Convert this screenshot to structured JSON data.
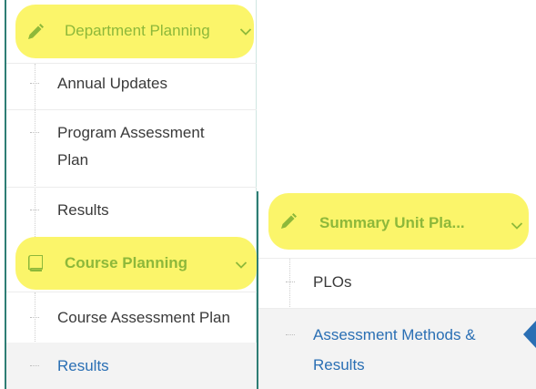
{
  "left_menu": {
    "department_planning": {
      "label": "Department Planning",
      "icon": "pencil-icon",
      "chevron": "chevron-down-icon"
    },
    "department_items": [
      "Annual Updates",
      "Program Assessment",
      "Plan",
      "Results"
    ],
    "course_planning": {
      "label": "Course Planning",
      "icon": "book-icon",
      "chevron": "chevron-down-icon"
    },
    "course_items": [
      "Course Assessment Plan",
      "Results"
    ]
  },
  "right_menu": {
    "summary_unit": {
      "label": "Summary Unit Pla...",
      "icon": "pencil-icon",
      "chevron": "chevron-down-icon"
    },
    "items": [
      "PLOs",
      "Assessment Methods &",
      "Results"
    ]
  },
  "colors": {
    "highlight": "#fbf56a",
    "header_green": "#8db83a",
    "link_blue": "#2a6fb4",
    "accent_teal": "#2e7d74"
  }
}
